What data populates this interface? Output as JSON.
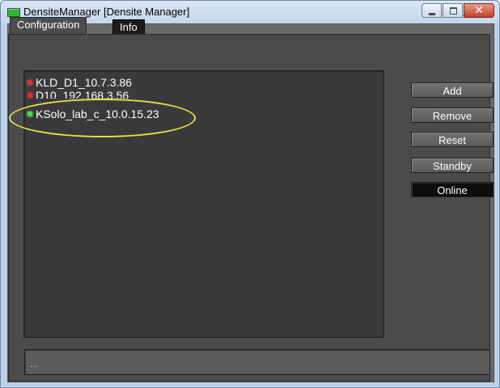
{
  "window": {
    "title": "DensiteManager [Densite Manager]",
    "app_icon": "app-status-icon",
    "caption_buttons": [
      "minimize",
      "maximize",
      "close"
    ]
  },
  "tabs": [
    {
      "label": "Configuration",
      "active": true
    },
    {
      "label": "Info",
      "active": false
    }
  ],
  "device_list": {
    "items": [
      {
        "label": "KLD_D1_10.7.3.86",
        "status": "red"
      },
      {
        "label": "D10_192.168.3.56",
        "status": "red"
      },
      {
        "label": "KSolo_lab_c_10.0.15.23",
        "status": "green",
        "highlighted": true
      }
    ]
  },
  "buttons": {
    "add": "Add",
    "remove": "Remove",
    "reset": "Reset",
    "standby": "Standby",
    "online": "Online"
  },
  "status_bar": {
    "text": "..."
  },
  "colors": {
    "status_red": "#e62a2a",
    "status_green": "#40e040",
    "highlight": "#e8e04a"
  }
}
